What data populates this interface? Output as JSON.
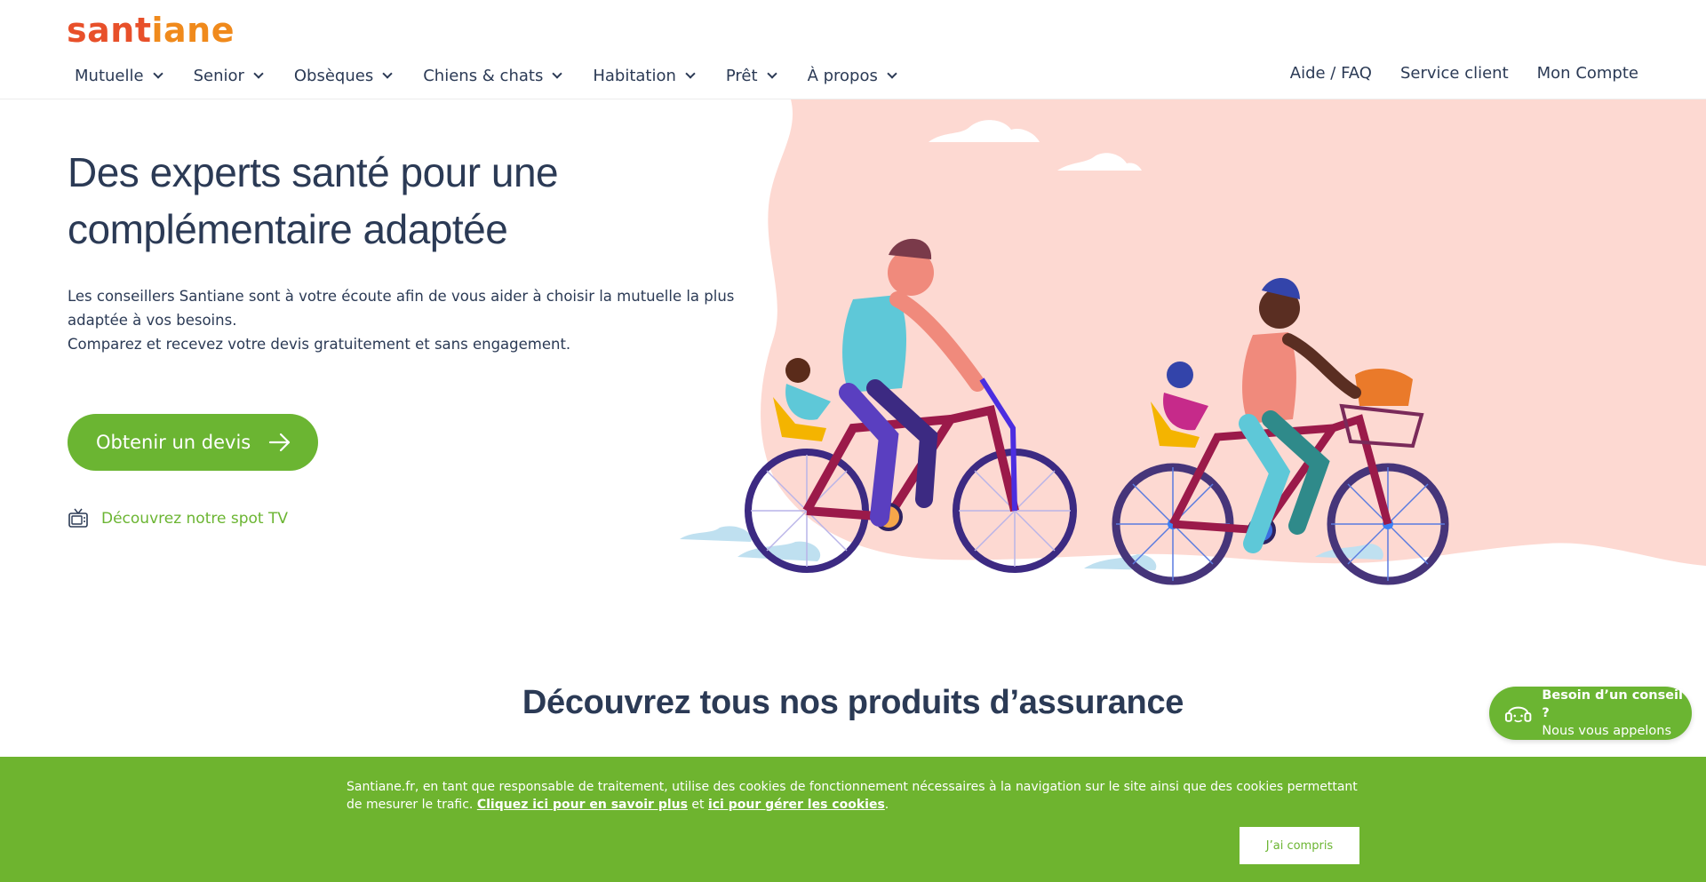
{
  "header": {
    "logo_part1": "sant",
    "logo_part2": "iane",
    "nav": [
      {
        "label": "Mutuelle"
      },
      {
        "label": "Senior"
      },
      {
        "label": "Obsèques"
      },
      {
        "label": "Chiens & chats"
      },
      {
        "label": "Habitation"
      },
      {
        "label": "Prêt"
      },
      {
        "label": "À propos"
      }
    ],
    "right_links": {
      "faq": "Aide / FAQ",
      "service": "Service client",
      "account": "Mon Compte"
    }
  },
  "hero": {
    "title": "Des experts santé pour une complémentaire adaptée",
    "text_line1": "Les conseillers Santiane sont à votre écoute afin de vous aider à choisir la mutuelle la plus adaptée à vos besoins.",
    "text_line2": "Comparez et recevez votre devis gratuitement et sans engagement.",
    "cta_label": "Obtenir un devis",
    "spot_label": "Découvrez notre spot TV"
  },
  "products": {
    "title": "Découvrez tous nos produits d’assurance"
  },
  "help": {
    "line1": "Besoin d’un conseil ?",
    "line2": "Nous vous appelons"
  },
  "cookie": {
    "text_before": "Santiane.fr, en tant que responsable de traitement, utilise des cookies de fonctionnement nécessaires à la navigation sur le site ainsi que des cookies permettant de mesurer le trafic. ",
    "link1": "Cliquez ici pour en savoir plus",
    "text_mid": " et ",
    "link2": "ici pour gérer les cookies",
    "text_after": ".",
    "accept_label": "J’ai compris"
  },
  "colors": {
    "brand_green": "#6bb532",
    "navy": "#2b3a55",
    "peach": "#fdd9d2",
    "logo_red": "#e8502a",
    "logo_orange": "#f08a1c"
  },
  "icons": [
    "chevron-down-icon",
    "arrow-right-icon",
    "tv-icon",
    "headset-icon"
  ]
}
